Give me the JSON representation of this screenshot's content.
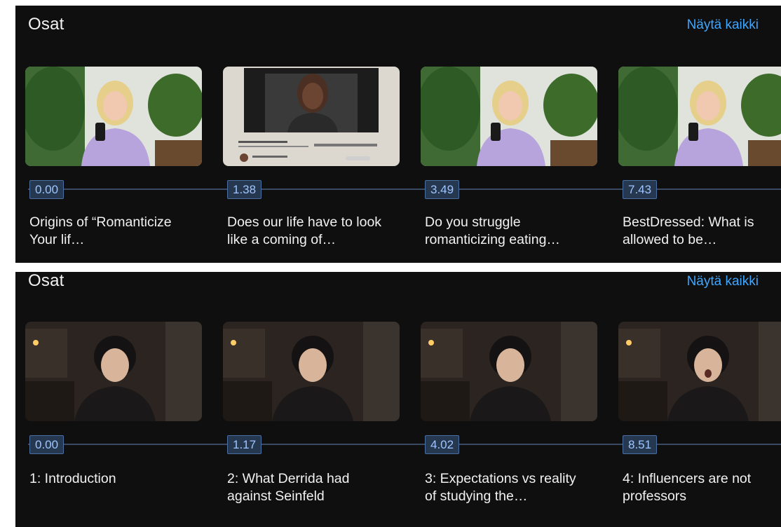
{
  "sections": [
    {
      "title": "Osat",
      "see_all": "Näytä kaikki",
      "chapters": [
        {
          "time": "0.00",
          "title": "Origins of “Romanticize Your lif…"
        },
        {
          "time": "1.38",
          "title": "Does our life have to look like a coming of…"
        },
        {
          "time": "3.49",
          "title": "Do you struggle romanticizing eating…"
        },
        {
          "time": "7.43",
          "title": "BestDressed: What is allowed to be…"
        }
      ]
    },
    {
      "title": "Osat",
      "see_all": "Näytä kaikki",
      "chapters": [
        {
          "time": "0.00",
          "title": "1: Introduction"
        },
        {
          "time": "1.17",
          "title": "2: What Derrida had against Seinfeld"
        },
        {
          "time": "4.02",
          "title": "3: Expectations vs reality of studying the…"
        },
        {
          "time": "8.51",
          "title": "4: Influencers are not professors"
        }
      ]
    }
  ],
  "colors": {
    "panel_bg": "#0f0f0f",
    "accent_link": "#3ea6ff",
    "timeline": "#3a4a63",
    "badge_bg": "#263850",
    "badge_text": "#9ec5ff"
  }
}
